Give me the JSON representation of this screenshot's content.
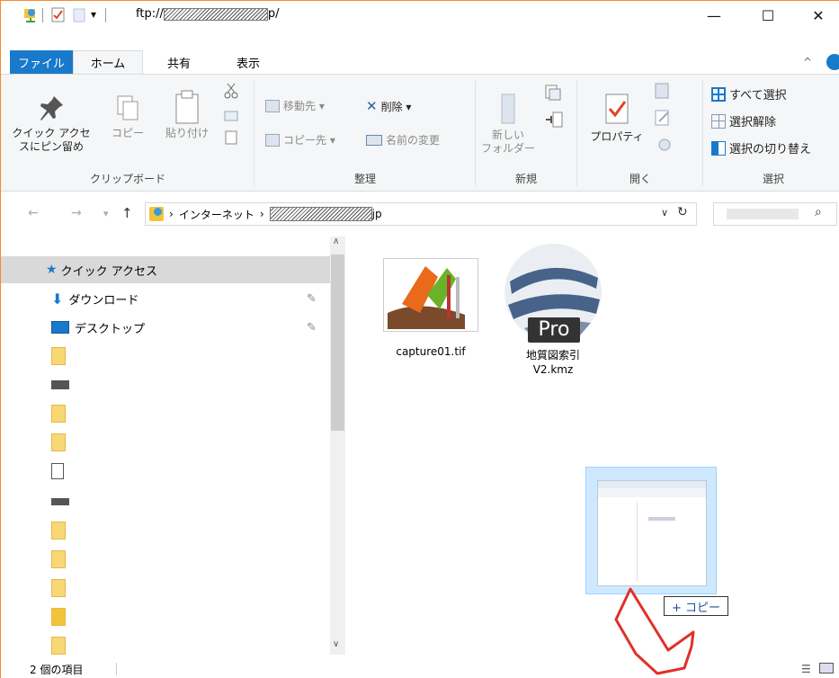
{
  "titlebar": {
    "path_prefix": "ftp://",
    "path_suffix": "p/",
    "minimize_glyph": "—",
    "maximize_glyph": "☐",
    "close_glyph": "✕"
  },
  "tabs": [
    {
      "label": "ファイル"
    },
    {
      "label": "ホーム"
    },
    {
      "label": "共有"
    },
    {
      "label": "表示"
    }
  ],
  "ribbon": {
    "clipboard": {
      "pin_label_1": "クイック アクセ",
      "pin_label_2": "スにピン留め",
      "copy_label": "コピー",
      "paste_label": "貼り付け",
      "group_label": "クリップボード"
    },
    "organize": {
      "move_label": "移動先 ▾",
      "delete_label": "削除 ▾",
      "copyto_label": "コピー先 ▾",
      "rename_label": "名前の変更",
      "group_label": "整理"
    },
    "new": {
      "new_folder_label_1": "新しい",
      "new_folder_label_2": "フォルダー",
      "group_label": "新規"
    },
    "open": {
      "properties_label": "プロパティ",
      "group_label": "開く"
    },
    "select": {
      "select_all": "すべて選択",
      "select_none": "選択解除",
      "invert": "選択の切り替え",
      "group_label": "選択"
    }
  },
  "address": {
    "segment_1": "インターネット",
    "segment_2_suffix": "jp"
  },
  "nav": {
    "quick_access": "クイック アクセス",
    "downloads": "ダウンロード",
    "desktop": "デスクトップ"
  },
  "files": [
    {
      "name": "capture01.tif"
    },
    {
      "name_line1": "地質図索引",
      "name_line2": "V2.kmz",
      "badge": "Pro"
    }
  ],
  "drag": {
    "tooltip": "+ コピー"
  },
  "status": {
    "count": "2 個の項目"
  },
  "colors": {
    "accent": "#1979ca",
    "window_border": "#f28b2f",
    "selection": "#cce8ff"
  }
}
